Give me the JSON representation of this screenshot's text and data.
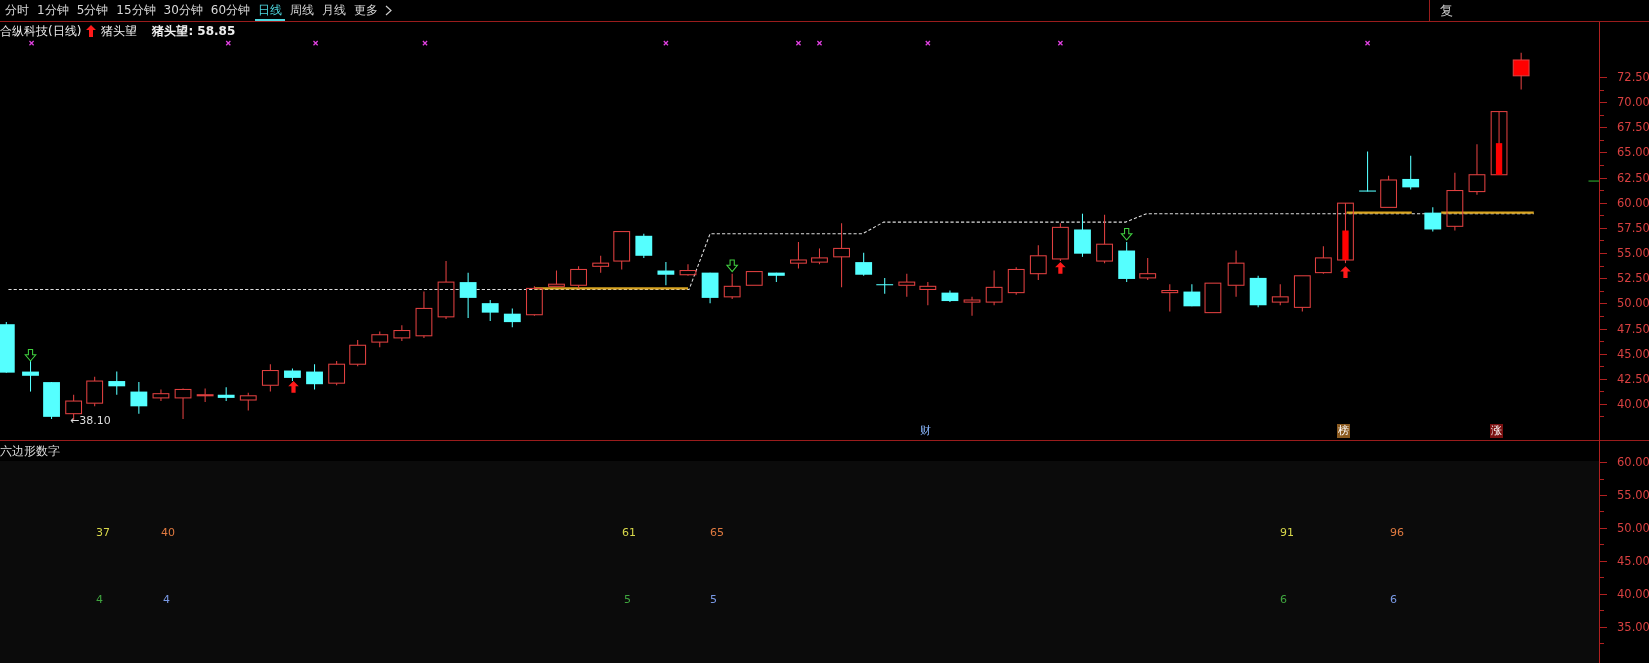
{
  "tabs": [
    {
      "label": "分时",
      "selected": false
    },
    {
      "label": "1分钟",
      "selected": false
    },
    {
      "label": "5分钟",
      "selected": false
    },
    {
      "label": "15分钟",
      "selected": false
    },
    {
      "label": "30分钟",
      "selected": false
    },
    {
      "label": "60分钟",
      "selected": false
    },
    {
      "label": "日线",
      "selected": true
    },
    {
      "label": "周线",
      "selected": false
    },
    {
      "label": "月线",
      "selected": false
    },
    {
      "label": "更多",
      "selected": false
    }
  ],
  "toolbar_right": {
    "label": "复"
  },
  "chart_title": {
    "stock": "合纵科技(日线)",
    "indicator": "猪头望",
    "readout": "猪头望: 58.85"
  },
  "main_chart": {
    "low_label": "←38.10",
    "event_badges": [
      {
        "text": "财",
        "kind": "finance"
      },
      {
        "text": "榜",
        "kind": "ranking"
      },
      {
        "text": "涨",
        "kind": "limit"
      }
    ],
    "y_axis": [
      "72.50",
      "70.00",
      "67.50",
      "65.00",
      "62.50",
      "60.00",
      "57.50",
      "55.00",
      "52.50",
      "50.00",
      "47.50",
      "45.00",
      "42.50",
      "40.00"
    ]
  },
  "sub_chart": {
    "title": "六边形数字",
    "numbers": [
      {
        "text": "37",
        "color": "#d8d84a"
      },
      {
        "text": "40",
        "color": "#e07a40"
      },
      {
        "text": "61",
        "color": "#d8d84a"
      },
      {
        "text": "65",
        "color": "#e07a40"
      },
      {
        "text": "91",
        "color": "#d8d84a"
      },
      {
        "text": "96",
        "color": "#e07a40"
      },
      {
        "text": "4",
        "color": "#3fa63f"
      },
      {
        "text": "4",
        "color": "#7a9ae6"
      },
      {
        "text": "5",
        "color": "#3fa63f"
      },
      {
        "text": "5",
        "color": "#7a9ae6"
      },
      {
        "text": "6",
        "color": "#3fa63f"
      },
      {
        "text": "6",
        "color": "#7a9ae6"
      }
    ],
    "y_axis": [
      "60.00",
      "55.00",
      "50.00",
      "45.00",
      "40.00",
      "35.00"
    ]
  }
}
